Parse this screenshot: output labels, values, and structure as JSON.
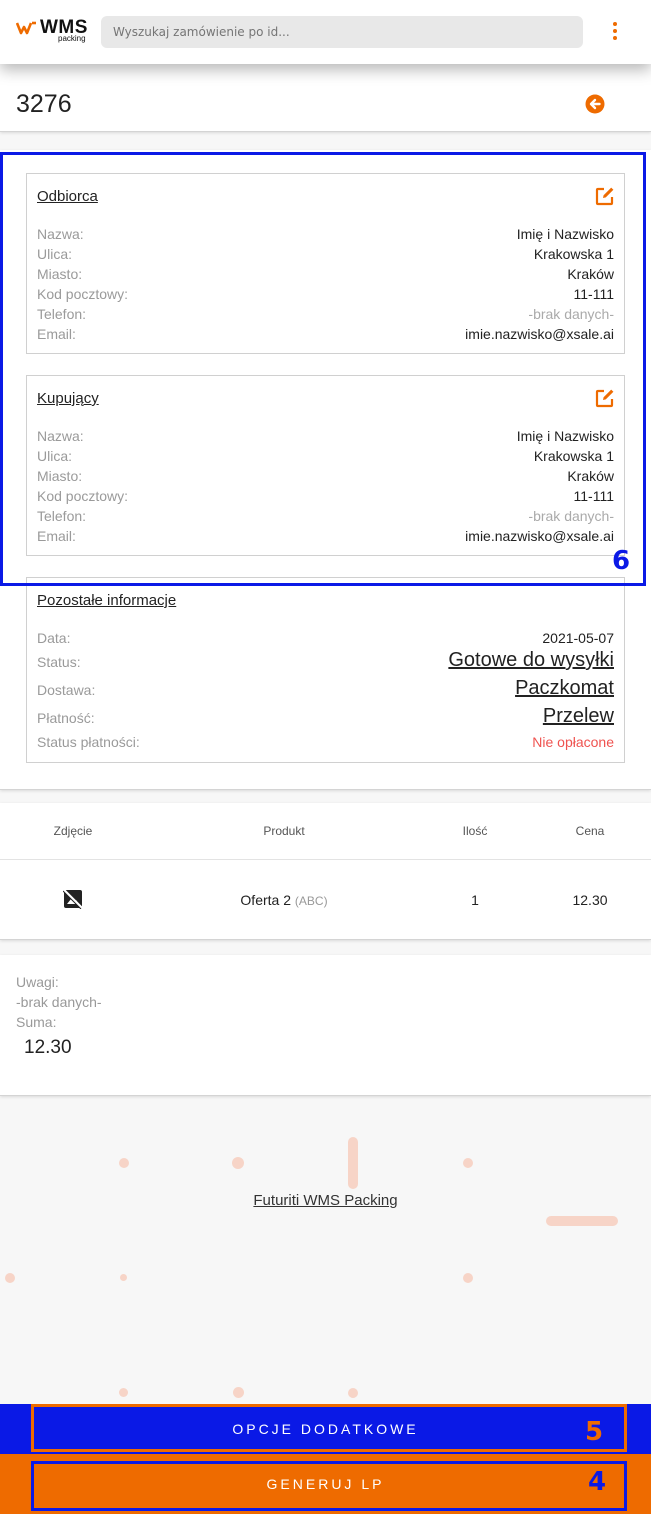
{
  "header": {
    "logo_text": "WMS",
    "logo_subtext": "packing",
    "search_placeholder": "Wyszukaj zamówienie po id..."
  },
  "order": {
    "id": "3276"
  },
  "recipient": {
    "title": "Odbiorca",
    "rows": [
      {
        "label": "Nazwa:",
        "value": "Imię i Nazwisko"
      },
      {
        "label": "Ulica:",
        "value": "Krakowska 1"
      },
      {
        "label": "Miasto:",
        "value": "Kraków"
      },
      {
        "label": "Kod pocztowy:",
        "value": "11-111"
      },
      {
        "label": "Telefon:",
        "value": "-brak danych-"
      },
      {
        "label": "Email:",
        "value": "imie.nazwisko@xsale.ai"
      }
    ]
  },
  "buyer": {
    "title": "Kupujący",
    "rows": [
      {
        "label": "Nazwa:",
        "value": "Imię i Nazwisko"
      },
      {
        "label": "Ulica:",
        "value": "Krakowska 1"
      },
      {
        "label": "Miasto:",
        "value": "Kraków"
      },
      {
        "label": "Kod pocztowy:",
        "value": "11-111"
      },
      {
        "label": "Telefon:",
        "value": "-brak danych-"
      },
      {
        "label": "Email:",
        "value": "imie.nazwisko@xsale.ai"
      }
    ]
  },
  "other_info": {
    "title": "Pozostałe informacje",
    "rows": [
      {
        "label": "Data:",
        "value": "2021-05-07"
      },
      {
        "label": "Status:",
        "value": "Gotowe do wysyłki"
      },
      {
        "label": "Dostawa:",
        "value": "Paczkomat"
      },
      {
        "label": "Płatność:",
        "value": "Przelew"
      },
      {
        "label": "Status płatności:",
        "value": "Nie opłacone"
      }
    ]
  },
  "products": {
    "headers": [
      "Zdjęcie",
      "Produkt",
      "Ilość",
      "Cena"
    ],
    "rows": [
      {
        "name": "Oferta 2",
        "code": "(ABC)",
        "qty": "1",
        "price": "12.30",
        "image_icon": "no-image-icon"
      }
    ]
  },
  "summary": {
    "notes_label": "Uwagi:",
    "notes_value": "-brak danych-",
    "total_label": "Suma:",
    "total_value": "12.30"
  },
  "footer": {
    "link_text": "Futuriti WMS Packing"
  },
  "actions": {
    "options_label": "OPCJE DODATKOWE",
    "generate_label": "GENERUJ LP"
  },
  "annotations": [
    {
      "number": "6",
      "color": "#0a19e6"
    },
    {
      "number": "5",
      "color": "#ee6b00"
    },
    {
      "number": "4",
      "color": "#0a19e6"
    }
  ],
  "colors": {
    "accent": "#ee6b00",
    "annotation_blue": "#0a19e6",
    "error_red": "#ef5350"
  }
}
